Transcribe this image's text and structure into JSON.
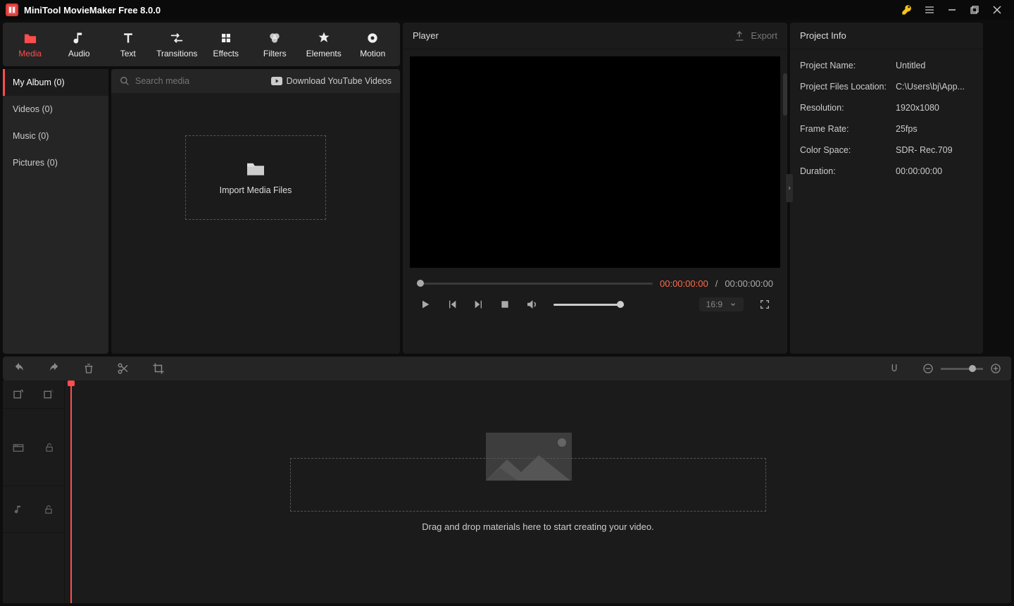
{
  "titlebar": {
    "title": "MiniTool MovieMaker Free 8.0.0"
  },
  "tabs": {
    "media": "Media",
    "audio": "Audio",
    "text": "Text",
    "transitions": "Transitions",
    "effects": "Effects",
    "filters": "Filters",
    "elements": "Elements",
    "motion": "Motion"
  },
  "sidebar": {
    "myalbum": "My Album (0)",
    "videos": "Videos (0)",
    "music": "Music (0)",
    "pictures": "Pictures (0)"
  },
  "media": {
    "search_placeholder": "Search media",
    "youtube_link": "Download YouTube Videos",
    "dropzone": "Import Media Files"
  },
  "player": {
    "title": "Player",
    "export": "Export",
    "current": "00:00:00:00",
    "sep": " / ",
    "total": "00:00:00:00",
    "aspect": "16:9"
  },
  "info": {
    "title": "Project Info",
    "name_label": "Project Name:",
    "name_value": "Untitled",
    "loc_label": "Project Files Location:",
    "loc_value": "C:\\Users\\bj\\App...",
    "res_label": "Resolution:",
    "res_value": "1920x1080",
    "fps_label": "Frame Rate:",
    "fps_value": "25fps",
    "cs_label": "Color Space:",
    "cs_value": "SDR- Rec.709",
    "dur_label": "Duration:",
    "dur_value": "00:00:00:00"
  },
  "timeline": {
    "hint": "Drag and drop materials here to start creating your video."
  }
}
